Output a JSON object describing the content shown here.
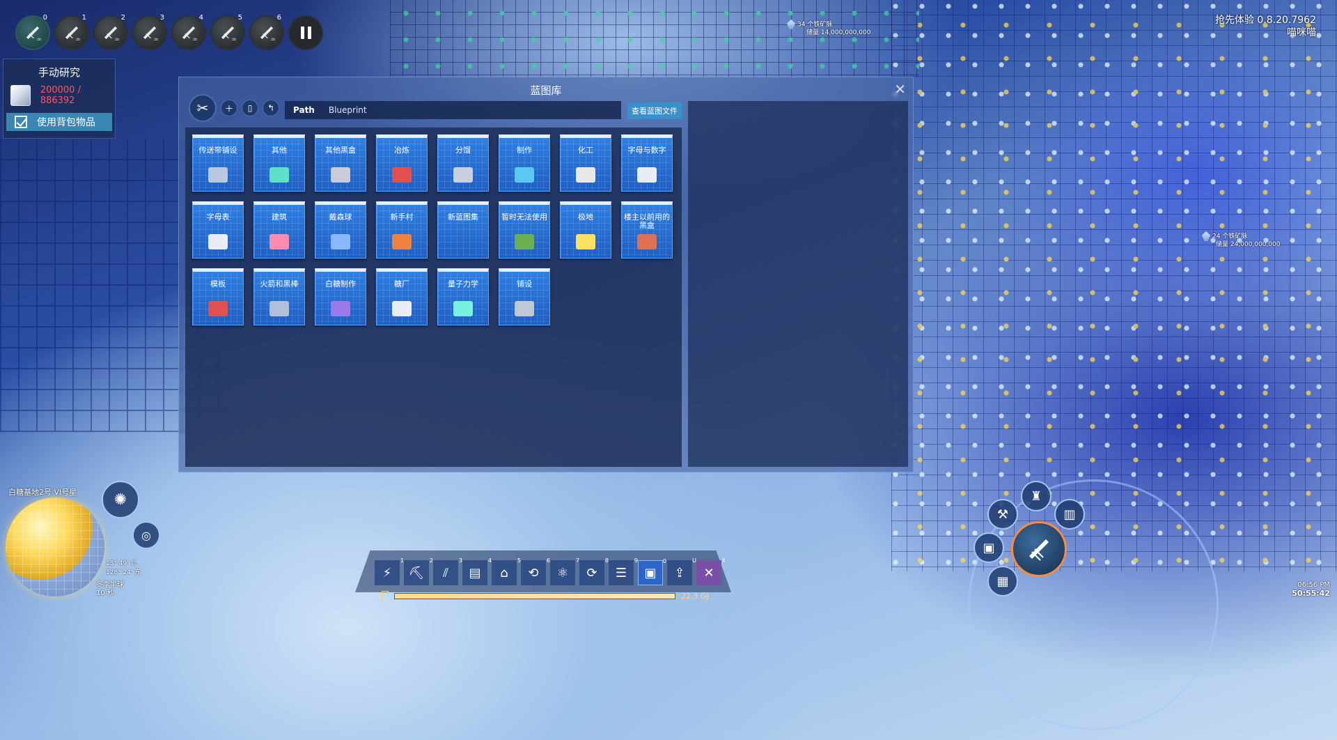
{
  "hud": {
    "drone_slots": [
      {
        "num": "0",
        "inf": "∞"
      },
      {
        "num": "1",
        "inf": "∞"
      },
      {
        "num": "2",
        "inf": "∞"
      },
      {
        "num": "3",
        "inf": "∞"
      },
      {
        "num": "4",
        "inf": "∞"
      },
      {
        "num": "5",
        "inf": "∞"
      },
      {
        "num": "6",
        "inf": "∞"
      }
    ],
    "version": "抢先体验 0.8.20.7962",
    "player": "喵咪喵"
  },
  "research": {
    "title": "手动研究",
    "count": "200000 / 886392",
    "use_inventory": "使用背包物品"
  },
  "veins": [
    {
      "line1": "34 个铁矿脉",
      "line2": "储量 14,000,000,000"
    },
    {
      "line1": "24 个铁矿脉",
      "line2": "储量 24,000,000,000"
    }
  ],
  "dialog": {
    "title": "蓝图库",
    "close": "✕",
    "path_label": "Path",
    "path_value": "Blueprint",
    "view_button": "查看蓝图文件",
    "folders": [
      {
        "name": "传送带铺设",
        "icon": "conveyor-icon",
        "color": "#b8c8e0"
      },
      {
        "name": "其他",
        "icon": "crystal-icon",
        "color": "#5fe0c8"
      },
      {
        "name": "其他黑盒",
        "icon": "tower-icon",
        "color": "#c8ccd8"
      },
      {
        "name": "冶炼",
        "icon": "smelter-icon",
        "color": "#e05050"
      },
      {
        "name": "分馏",
        "icon": "fractionator-icon",
        "color": "#c8d0e0"
      },
      {
        "name": "制作",
        "icon": "assembler-icon",
        "color": "#5ac8f0"
      },
      {
        "name": "化工",
        "icon": "chemical-plant-icon",
        "color": "#e8e8e8"
      },
      {
        "name": "字母与数字",
        "icon": "triangle-icon",
        "color": "#e8ecf4"
      },
      {
        "name": "字母表",
        "icon": "prism-icon",
        "color": "#e8ecf4"
      },
      {
        "name": "建筑",
        "icon": "marker-icon",
        "color": "#ff8ab0"
      },
      {
        "name": "戴森球",
        "icon": "satellite-icon",
        "color": "#8ab8ff"
      },
      {
        "name": "新手村",
        "icon": "factory-icon",
        "color": "#f08040"
      },
      {
        "name": "新蓝图集",
        "icon": "empty-icon",
        "color": "transparent"
      },
      {
        "name": "暂时无法使用",
        "icon": "ore-icon",
        "color": "#6ab050"
      },
      {
        "name": "极地",
        "icon": "light-bulb-icon",
        "color": "#ffe060"
      },
      {
        "name": "楼主以前用的黑盒",
        "icon": "cluster-icon",
        "color": "#e07050"
      },
      {
        "name": "模板",
        "icon": "building-icon",
        "color": "#e05050"
      },
      {
        "name": "火箭和黑棒",
        "icon": "rocket-icon",
        "color": "#b0c0d8"
      },
      {
        "name": "白糖制作",
        "icon": "cubes-icon",
        "color": "#9a7ae8"
      },
      {
        "name": "糖厂",
        "icon": "cube-icon",
        "color": "#e8ecf4"
      },
      {
        "name": "量子力学",
        "icon": "quantum-icon",
        "color": "#7af0e0"
      },
      {
        "name": "铺设",
        "icon": "solar-panel-icon",
        "color": "#c0c8d8"
      }
    ]
  },
  "planet": {
    "name": "白糖基地2号 VI号星",
    "lat": "13° 49' 北",
    "lon": "128° 24' 东",
    "season": "冬季半球",
    "season_time": "10 秒"
  },
  "bottom_bar": {
    "items": [
      {
        "key": "1",
        "icon": "power-icon",
        "glyph": "⚡"
      },
      {
        "key": "2",
        "icon": "mining-icon",
        "glyph": "⛏"
      },
      {
        "key": "3",
        "icon": "conveyor-icon",
        "glyph": "⫽"
      },
      {
        "key": "4",
        "icon": "storage-icon",
        "glyph": "▤"
      },
      {
        "key": "5",
        "icon": "factory-icon",
        "glyph": "⌂"
      },
      {
        "key": "6",
        "icon": "logistics-icon",
        "glyph": "⟲"
      },
      {
        "key": "7",
        "icon": "chemistry-icon",
        "glyph": "⚛"
      },
      {
        "key": "8",
        "icon": "research-icon",
        "glyph": "⟳"
      },
      {
        "key": "9",
        "icon": "wall-icon",
        "glyph": "☰"
      },
      {
        "key": "0",
        "icon": "blueprint-icon",
        "glyph": "▣"
      },
      {
        "key": "U",
        "icon": "upgrade-icon",
        "glyph": "⇪"
      },
      {
        "key": "X",
        "icon": "dismantle-icon",
        "glyph": "✕"
      }
    ],
    "energy_fraction": 1.0,
    "energy_value": "22.3 GJ"
  },
  "clock": {
    "time": "06:56 PM",
    "playtime": "50:55:42"
  }
}
